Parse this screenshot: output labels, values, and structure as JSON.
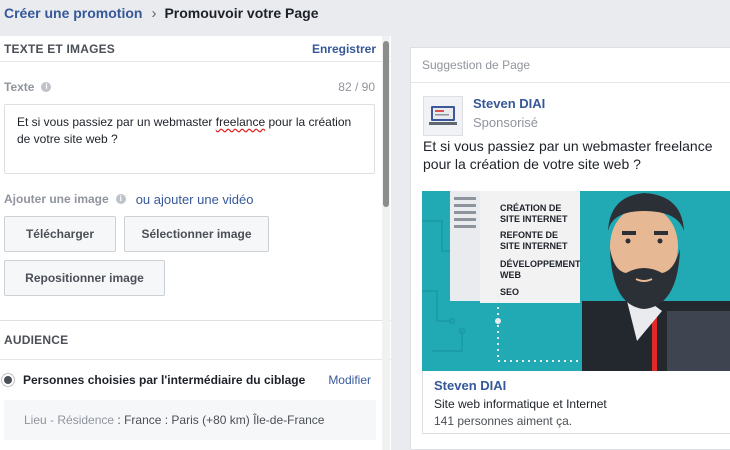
{
  "breadcrumb": {
    "parent": "Créer une promotion",
    "current": "Promouvoir votre Page"
  },
  "text_images": {
    "title": "TEXTE ET IMAGES",
    "save": "Enregistrer",
    "text_label": "Texte",
    "counter": "82 / 90",
    "text_value_a": "Et si vous passiez par un webmaster ",
    "text_value_b": "freelance",
    "text_value_c": " pour la création de votre site web ?",
    "image_label": "Ajouter une image",
    "video_link": "ou ajouter une vidéo",
    "upload": "Télécharger",
    "select_image": "Sélectionner image",
    "reposition": "Repositionner image"
  },
  "audience": {
    "title": "AUDIENCE",
    "option": "Personnes choisies par l'intermédiaire du ciblage",
    "modify": "Modifier",
    "loc_key": "Lieu - Résidence",
    "loc_value": " : France : Paris (+80 km) Île-de-France"
  },
  "preview": {
    "header": "Suggestion de Page",
    "page_name": "Steven DIAI",
    "sponsored": "Sponsorisé",
    "post_text": "Et si vous passiez par un webmaster freelance pour la création de votre site web ?",
    "services": [
      "CRÉATION DE",
      "SITE INTERNET",
      "REFONTE DE",
      "SITE INTERNET",
      "DÉVELOPPEMENT",
      "WEB",
      "SEO"
    ],
    "footer_name": "Steven DIAI",
    "footer_category": "Site web informatique et Internet",
    "footer_likes": "141 personnes aiment ça."
  },
  "colors": {
    "link": "#365899",
    "creative_bg": "#21aab4",
    "beard": "#2b2f36"
  }
}
